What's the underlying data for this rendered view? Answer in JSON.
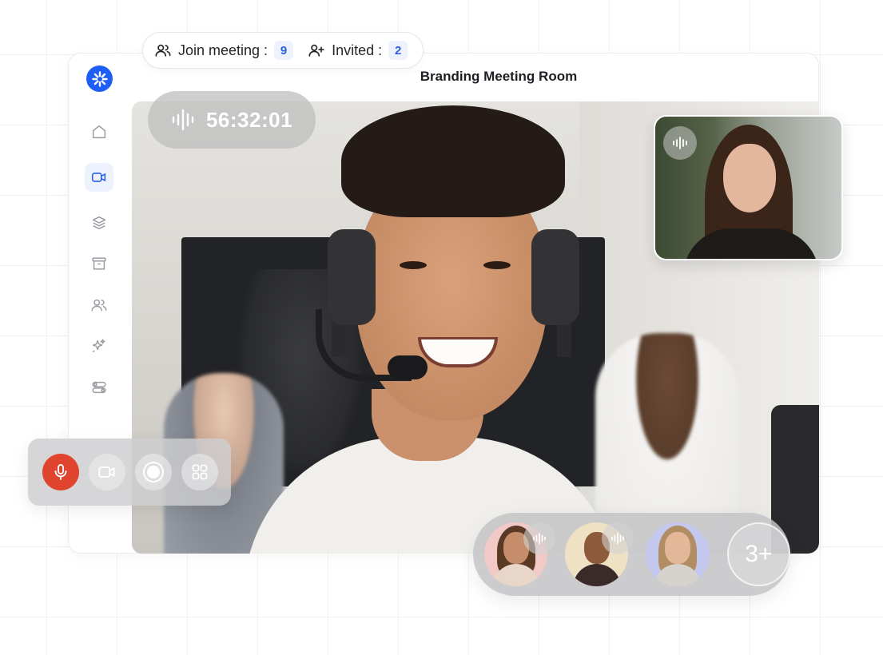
{
  "header": {
    "join_label": "Join meeting :",
    "join_count": "9",
    "invited_label": "Invited :",
    "invited_count": "2"
  },
  "room": {
    "title": "Branding Meeting Room"
  },
  "call": {
    "timer": "56:32:01"
  },
  "sidebar": {
    "items": [
      {
        "icon": "home-icon"
      },
      {
        "icon": "video-icon",
        "active": true
      },
      {
        "icon": "layers-icon"
      },
      {
        "icon": "archive-icon"
      },
      {
        "icon": "users-icon"
      },
      {
        "icon": "sparkle-icon"
      },
      {
        "icon": "toggles-icon"
      }
    ]
  },
  "controls": {
    "buttons": [
      {
        "icon": "microphone-icon",
        "active": true
      },
      {
        "icon": "camera-icon"
      },
      {
        "icon": "record-icon"
      },
      {
        "icon": "grid-icon"
      }
    ]
  },
  "participants": {
    "more_label": "3+"
  },
  "colors": {
    "accent": "#1f5ef5",
    "mic_active": "#e0432e"
  }
}
